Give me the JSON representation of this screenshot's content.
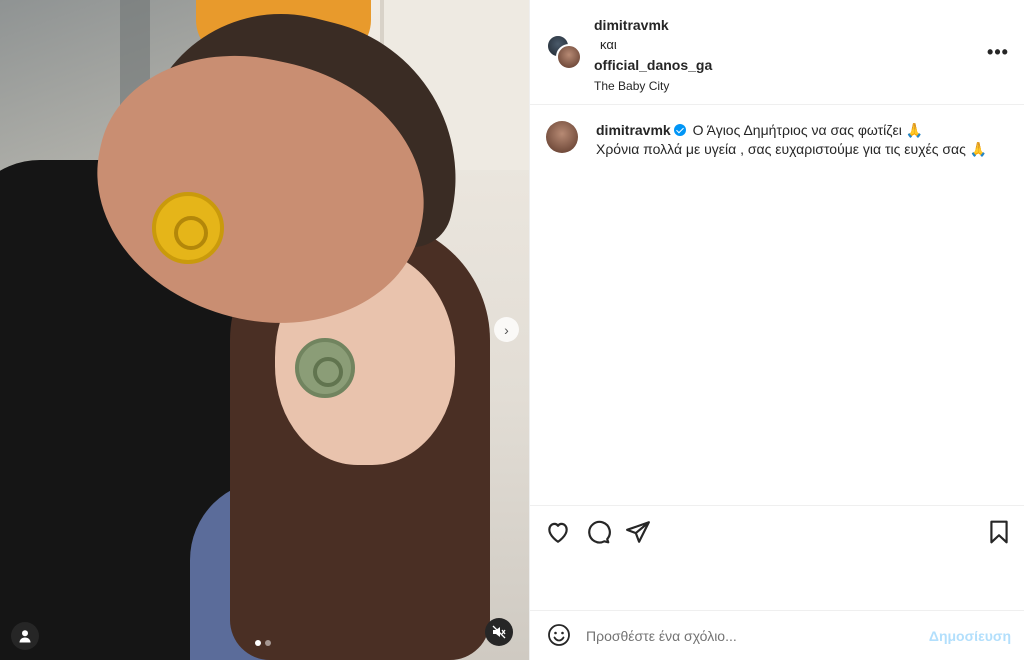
{
  "header": {
    "user1": "dimitravmk",
    "connector": "και",
    "user2": "official_danos_ga",
    "location": "The Baby City",
    "more_label": "•••"
  },
  "caption": {
    "username": "dimitravmk",
    "line1": "Ο Άγιος Δημήτριος να σας φωτίζει 🙏",
    "line2": "Χρόνια πολλά με υγεία , σας ευχαριστούμε για τις ευχές σας 🙏"
  },
  "media": {
    "carousel_count": 2,
    "carousel_active": 1
  },
  "comment": {
    "placeholder": "Προσθέστε ένα σχόλιο...",
    "post_label": "Δημοσίευση"
  },
  "colors": {
    "link_disabled": "#b2dffc",
    "verified": "#0095f6",
    "text": "#262626"
  }
}
